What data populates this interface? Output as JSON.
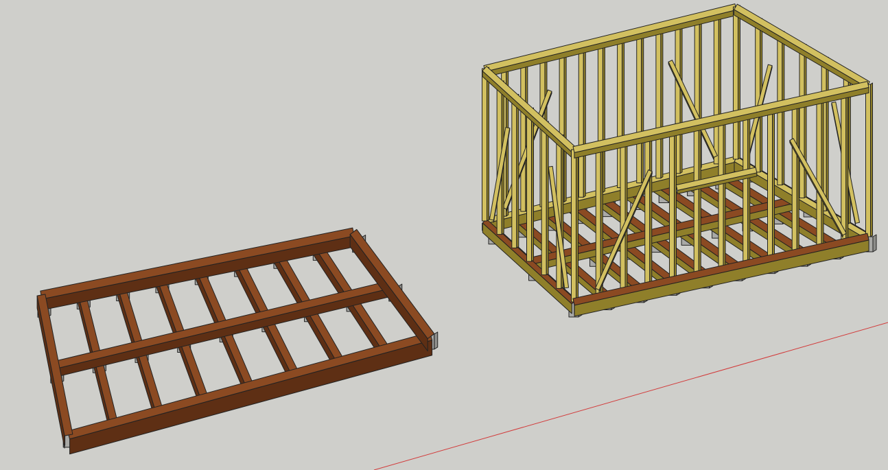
{
  "scene": {
    "background_color": "#cfcfcb",
    "axis_color": "#d23a3a",
    "models": [
      {
        "name": "floor-frame",
        "material_color": "#8b4a22",
        "material_shadow": "#5e2f14",
        "support_color": "#a9a9a6"
      },
      {
        "name": "wall-frame",
        "material_color": "#d2c060",
        "material_shadow": "#8f7f2a",
        "floor_color": "#8b4a22",
        "support_color": "#a9a9a6"
      }
    ]
  }
}
